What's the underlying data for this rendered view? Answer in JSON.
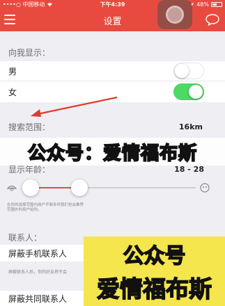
{
  "status_bar": {
    "carrier": "••••○ 中国移动",
    "time": "下午4:39",
    "battery": "48%"
  },
  "navbar": {
    "title": "设置"
  },
  "show_me": {
    "section_title": "向我显示：",
    "male_label": "男",
    "male_on": false,
    "female_label": "女",
    "female_on": true
  },
  "search": {
    "label": "搜索范围：",
    "value": "16km"
  },
  "age": {
    "label": "显示年龄：",
    "value": "18 - 28",
    "note": "在你的选择范围内用户不够多时我们也会推荐范围外的用户给你。"
  },
  "watermark_bar": "公众号：爱情福布斯",
  "contacts": {
    "section_title": "联系人：",
    "block_phone_label": "屏蔽手机联系人",
    "block_phone_desc": "屏蔽联系人后，你的好友将不会",
    "block_common_label": "屏蔽共同联系人"
  },
  "watermark_box": {
    "line1": "公众号",
    "line2": "爱情福布斯"
  },
  "colors": {
    "brand_red": "#e94a3f",
    "toggle_green": "#4cd964"
  }
}
